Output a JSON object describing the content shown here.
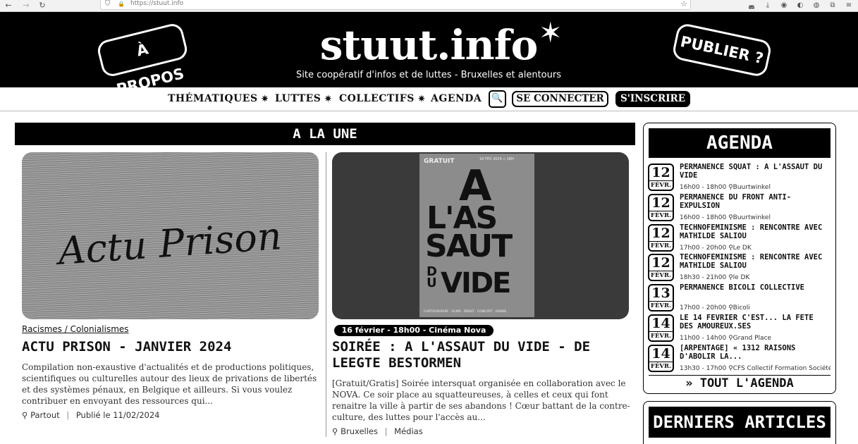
{
  "browser": {
    "url": "https://stuut.info",
    "back": "←",
    "forward": "→",
    "reload": "↻",
    "shield": "⛉",
    "lock": "🔒",
    "star": "☆",
    "menu": "≡"
  },
  "site": {
    "logo": "stuut.info",
    "logo_star": "✶",
    "tagline": "Site coopératif d'infos et de luttes - Bruxelles et alentours",
    "apropos": "À PROPOS",
    "publier": "PUBLIER ?"
  },
  "nav": {
    "items": [
      "THÉMATIQUES",
      "LUTTES",
      "COLLECTIFS",
      "AGENDA"
    ],
    "star": "✷",
    "search": "🔍",
    "login": "SE CONNECTER",
    "signup": "S'INSCRIRE"
  },
  "une": {
    "heading": "A LA UNE"
  },
  "articles": [
    {
      "category": "Racismes / Colonialismes",
      "image_text": "Actu Prison",
      "title": "ACTU PRISON - JANVIER 2024",
      "excerpt": "Compilation non-exaustive d'actualités et de productions politiques, scientifiques ou culturelles autour des lieux de privations de libertés et des systèmes pénaux, en Belgique et ailleurs. Si vous voulez contribuer en envoyant des ressources qui...",
      "location": "Partout",
      "published": "Publié le 11/02/2024"
    },
    {
      "date_badge": "16 février - 18h00 - Cinéma Nova",
      "title": "SOIRÉE : A L'ASSAUT DU VIDE - DE LEEGTE BESTORMEN",
      "excerpt": "[Gratuit/Gratis] Soirée intersquat organisée en collaboration avec le NOVA. Ce soir place au squatteureuses, à celles et ceux qui font renaitre la ville à partir de ses abandons ! Cœur battant de la contre-culture, des luttes pour l'accès au...",
      "location": "Bruxelles",
      "tag": "Médias"
    }
  ],
  "poster": {
    "line1": "A",
    "line2": "L'AS",
    "line3": "SAUT",
    "line4": "DU",
    "line5": "VIDE",
    "gratuit": "GRATUIT",
    "date": "16 FEV 2024 ◇ 18H",
    "footer": "CARTOGRAPHIE · FILMS · DÉBAT · CONCERT · DANSE"
  },
  "agenda": {
    "title": "AGENDA",
    "all": "» TOUT L'AGENDA",
    "events": [
      {
        "day": "12",
        "month": "FÉVR.",
        "title": "PERMANENCE SQUAT : A L'ASSAUT DU VIDE",
        "time": "16h00 - 18h00",
        "place": "Buurtwinkel"
      },
      {
        "day": "12",
        "month": "FÉVR.",
        "title": "PERMANENCE DU FRONT ANTI-EXPULSION",
        "time": "16h00 - 18h00",
        "place": "Buurtwinkel"
      },
      {
        "day": "12",
        "month": "FÉVR.",
        "title": "TECHNOFEMINISME : RENCONTRE AVEC MATHILDE SALIOU",
        "time": "17h00 - 20h00",
        "place": "Le DK"
      },
      {
        "day": "12",
        "month": "FÉVR.",
        "title": "TECHNOFEMINISME : RENCONTRE AVEC MATHILDE SALIOU",
        "time": "18h30 - 21h00",
        "place": "le DK"
      },
      {
        "day": "13",
        "month": "FÉVR.",
        "title": "PERMANENCE BICOLI COLLECTIVE",
        "time": "17h00 - 20h00",
        "place": "Bicoli"
      },
      {
        "day": "14",
        "month": "FÉVR.",
        "title": "LE 14 FEVRIER C'EST... LA FETE DES AMOUREUX.SES",
        "time": "11h00 - 14h00",
        "place": "Grand Place"
      },
      {
        "day": "14",
        "month": "FÉVR.",
        "title": "[ARPENTAGE] « 1312 RAISONS D'ABOLIR LA...",
        "time": "13h30 - 17h00",
        "place": "CFS Collectif Formation Société"
      }
    ]
  },
  "derniers": {
    "title": "DERNIERS ARTICLES"
  }
}
